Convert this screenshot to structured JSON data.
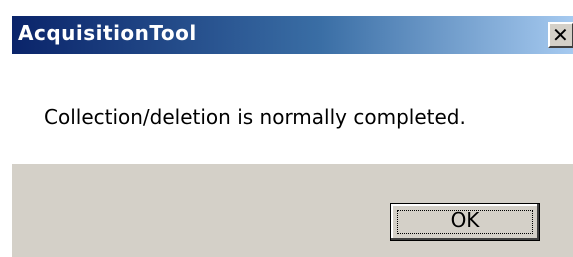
{
  "window": {
    "title": "AcquisitionTool",
    "close_glyph": "✕",
    "close_icon": "close-icon"
  },
  "message": {
    "text": "Collection/deletion is normally completed."
  },
  "buttons": {
    "ok_label": "OK"
  },
  "colors": {
    "title_bar_start": "#0a246a",
    "title_bar_end": "#a6caf0",
    "dialog_face": "#d4d0c8",
    "message_background": "#ffffff"
  }
}
